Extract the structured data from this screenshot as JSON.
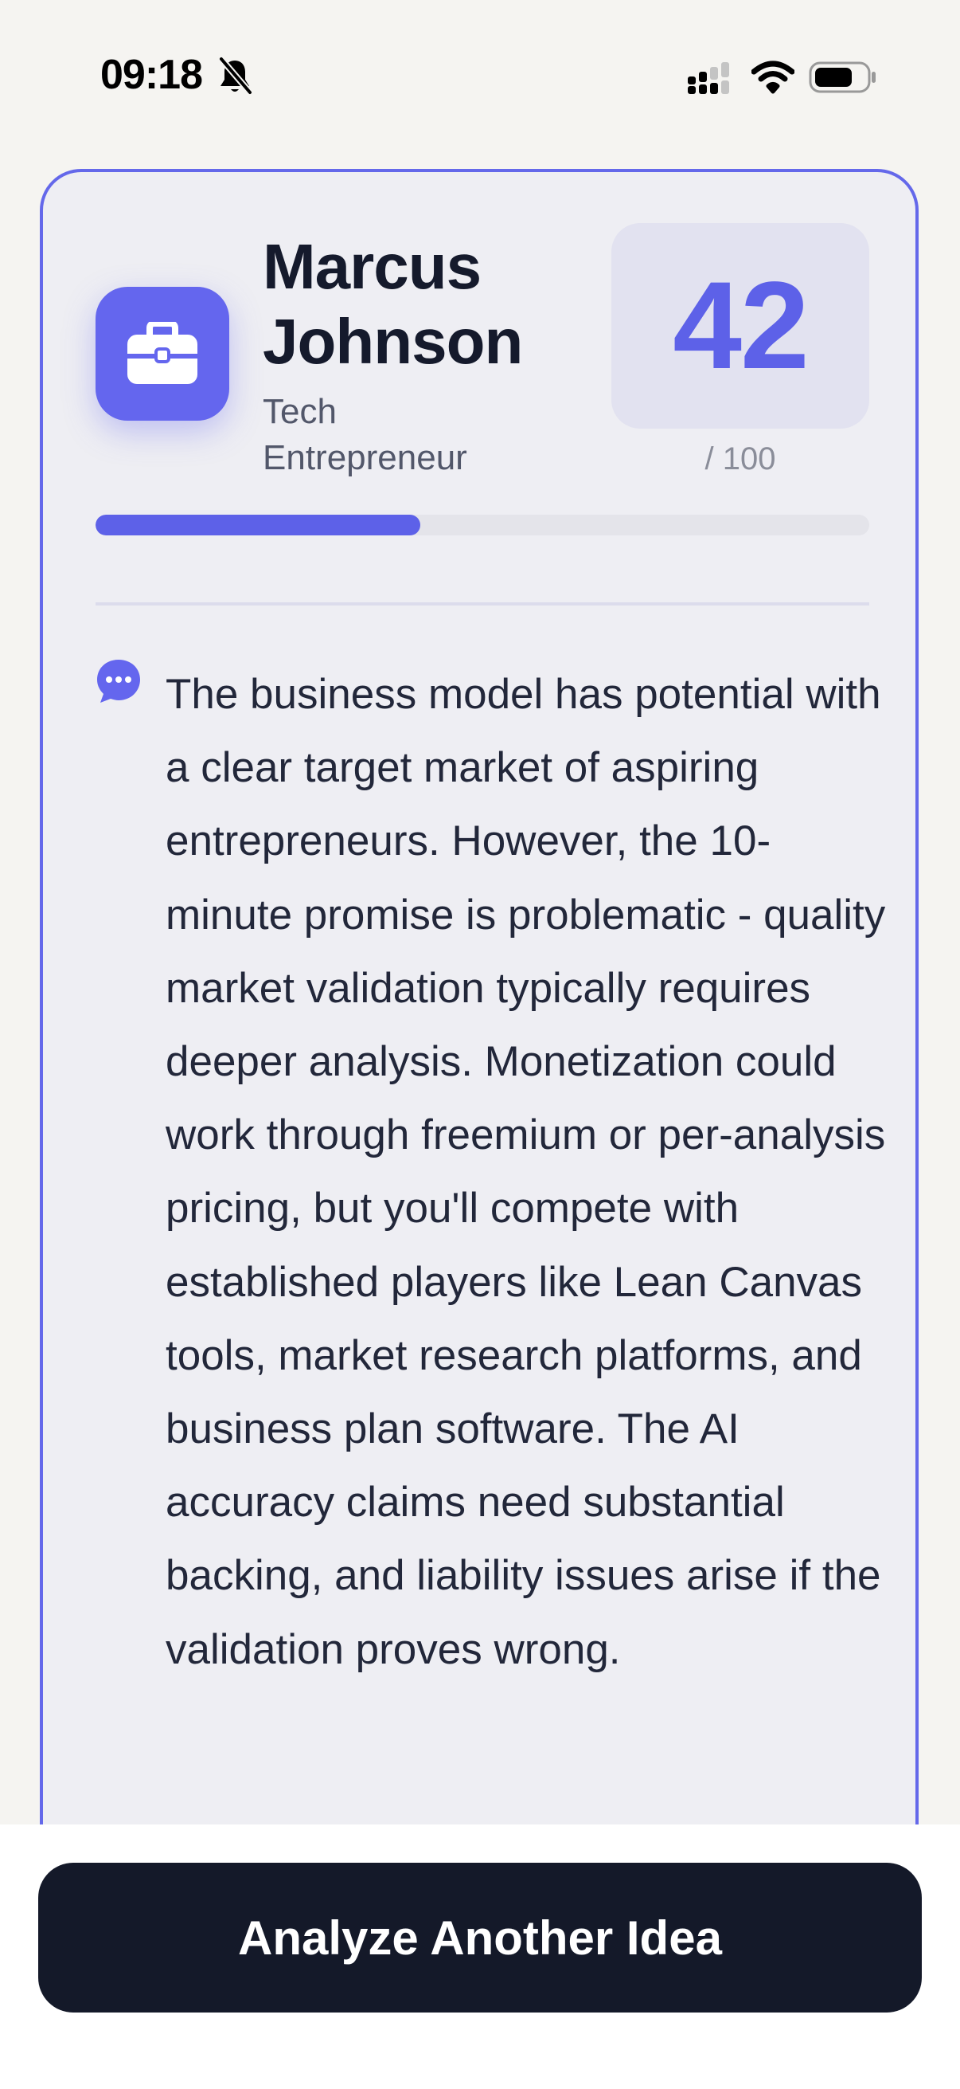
{
  "status_bar": {
    "time": "09:18",
    "icons": [
      "bell-slash-icon",
      "cellular-signal-icon",
      "wifi-icon",
      "battery-icon"
    ]
  },
  "profile": {
    "icon": "briefcase-icon",
    "name": "Marcus Johnson",
    "role": "Tech Entrepreneur"
  },
  "score": {
    "value": "42",
    "max_label": "/ 100",
    "progress_fraction": 0.42
  },
  "feedback": {
    "icon": "chat-bubble-icon",
    "text": "The business model has potential with a clear target market of aspiring entrepreneurs. However, the 10-minute promise is problematic - quality market validation typically requires deeper analysis. Monetization could work through freemium or per-analysis pricing, but you'll compete with established players like Lean Canvas tools, market research platforms, and business plan software. The AI accuracy claims need substantial backing, and liability issues arise if the validation proves wrong."
  },
  "actions": {
    "analyze_label": "Analyze Another Idea"
  },
  "colors": {
    "accent": "#6466ee",
    "card_background": "#eeeef3",
    "button_background": "#141929"
  }
}
